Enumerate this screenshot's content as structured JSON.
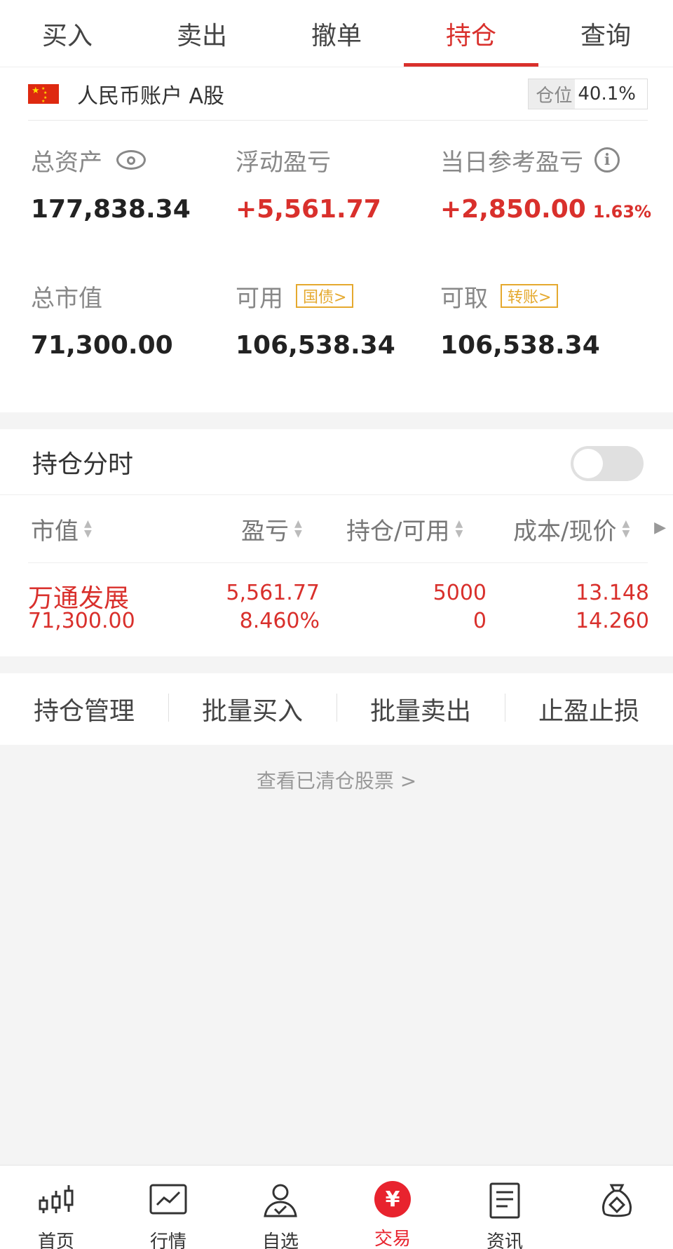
{
  "tabs": [
    {
      "label": "买入"
    },
    {
      "label": "卖出"
    },
    {
      "label": "撤单"
    },
    {
      "label": "持仓",
      "active": true
    },
    {
      "label": "查询"
    }
  ],
  "account": {
    "name": "人民币账户 A股",
    "position_label": "仓位",
    "position_value": "40.1%"
  },
  "summary": {
    "total_assets_label": "总资产",
    "total_assets": "177,838.34",
    "floating_pl_label": "浮动盈亏",
    "floating_pl": "+5,561.77",
    "daily_pl_label": "当日参考盈亏",
    "daily_pl": "+2,850.00",
    "daily_pl_pct": "1.63%",
    "market_value_label": "总市值",
    "market_value": "71,300.00",
    "available_label": "可用",
    "available_tag": "国债>",
    "available": "106,538.34",
    "withdrawable_label": "可取",
    "withdrawable_tag": "转账>",
    "withdrawable": "106,538.34"
  },
  "holdings": {
    "title": "持仓分时",
    "toggle_on": false,
    "columns": [
      "市值",
      "盈亏",
      "持仓/可用",
      "成本/现价"
    ],
    "rows": [
      {
        "name": "万通发展",
        "market_value": "71,300.00",
        "pl": "5,561.77",
        "pl_pct": "8.460%",
        "holding": "5000",
        "available": "0",
        "cost": "13.148",
        "price": "14.260"
      }
    ]
  },
  "actions": [
    "持仓管理",
    "批量买入",
    "批量卖出",
    "止盈止损"
  ],
  "cleared_link": "查看已清仓股票 >",
  "bottom_nav": [
    {
      "label": "首页",
      "icon": "candlestick-icon"
    },
    {
      "label": "行情",
      "icon": "market-chart-icon"
    },
    {
      "label": "自选",
      "icon": "user-check-icon"
    },
    {
      "label": "交易",
      "icon": "yuan-icon",
      "active": true
    },
    {
      "label": "资讯",
      "icon": "document-icon"
    },
    {
      "label": "",
      "icon": "money-bag-icon"
    }
  ],
  "colors": {
    "accent": "#d9302c",
    "tag": "#e5a92e",
    "nav_active": "#e8232e"
  }
}
